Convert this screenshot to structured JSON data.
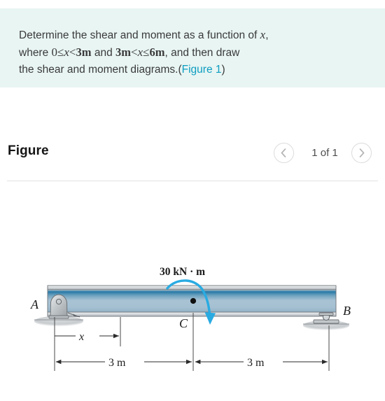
{
  "problem": {
    "line1_a": "Determine the shear and moment as a function of ",
    "line1_x": "x",
    "line1_b": ",",
    "line2_a": "where ",
    "line2_zero": "0",
    "line2_le1": "≤",
    "line2_x1": "x",
    "line2_lt1": "<",
    "line2_3m_1": "3m",
    "line2_and1": " and ",
    "line2_3m_2": "3m",
    "line2_lt2": "<",
    "line2_x2": "x",
    "line2_le2": "≤",
    "line2_6m": "6m",
    "line2_tail": ", and then draw",
    "line3_a": "the shear and moment diagrams.(",
    "line3_link": "Figure 1",
    "line3_b": ")",
    "panel_bg": "#e8f5f3",
    "link_color": "#0d9dc0"
  },
  "figure_header": {
    "title": "Figure",
    "counter": "1 of 1",
    "prev_icon": "chevron-left-icon",
    "next_icon": "chevron-right-icon"
  },
  "diagram": {
    "moment_label": "30 kN · m",
    "label_A": "A",
    "label_B": "B",
    "label_C": "C",
    "label_x": "x",
    "dim_left": "3 m",
    "dim_right": "3 m",
    "beam_color_top": "#1f6f9e",
    "beam_color_body": "#a8c4d6",
    "arrow_color": "#29abe2",
    "support_color": "#b8bcbf"
  }
}
